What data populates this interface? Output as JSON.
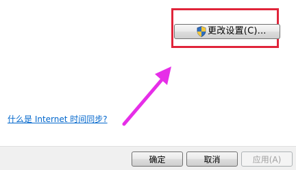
{
  "change_settings_button": {
    "label": "更改设置(C)...",
    "icon": "uac-shield-icon"
  },
  "help_link": {
    "text": "什么是 Internet 时间同步?"
  },
  "footer": {
    "ok_label": "确定",
    "cancel_label": "取消",
    "apply_label": "应用(A)"
  },
  "annotation": {
    "highlight_color": "#e0243a",
    "arrow_color": "#e62ee8"
  }
}
